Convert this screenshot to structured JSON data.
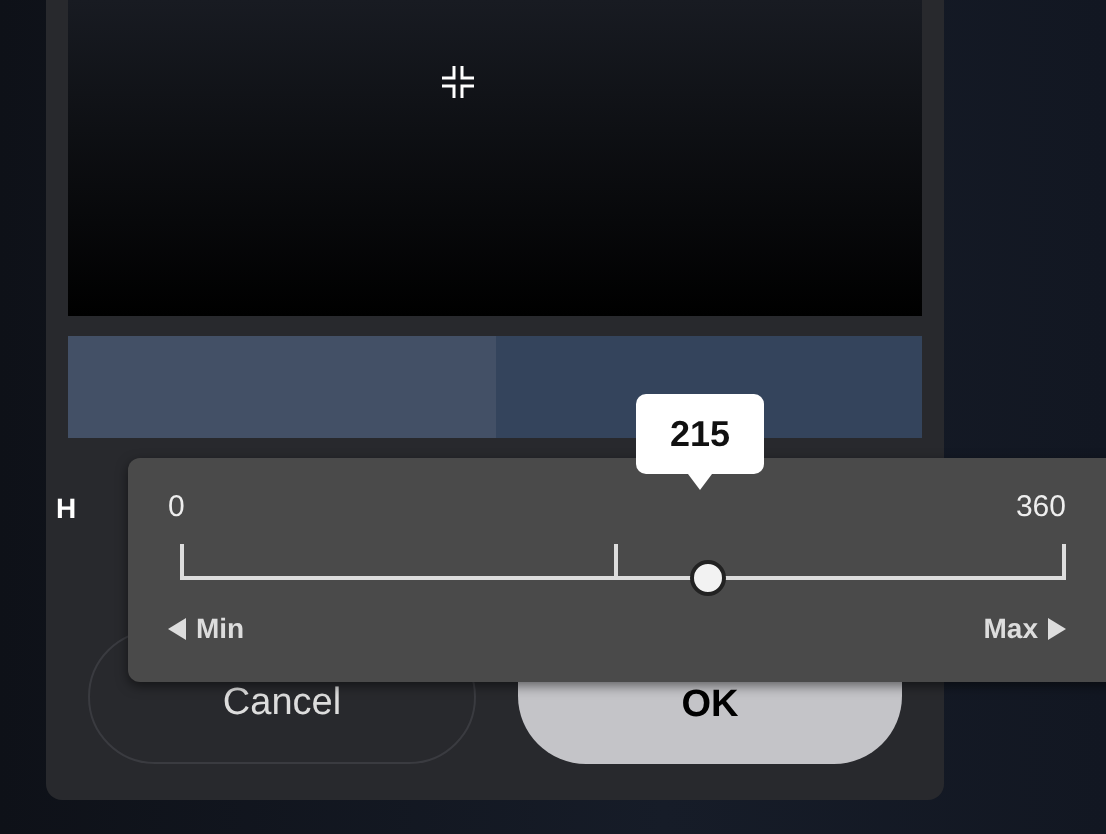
{
  "picker": {
    "swatches": [
      {
        "color": "#435066"
      },
      {
        "color": "#34445c"
      }
    ],
    "channel_label": "H",
    "buttons": [
      {
        "label": "Cancel",
        "kind": "secondary"
      },
      {
        "label": "OK",
        "kind": "primary"
      }
    ]
  },
  "slider_popup": {
    "value": "215",
    "min_label": "0",
    "max_label": "360",
    "level": 0.597,
    "min_button": "Min",
    "max_button": "Max"
  }
}
